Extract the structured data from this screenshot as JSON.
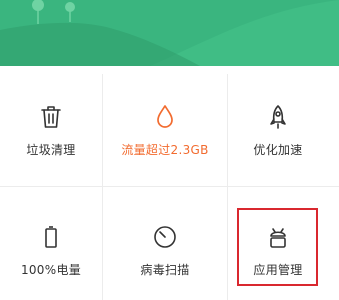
{
  "header": {
    "background": "#3ab57f",
    "hill_color": "#2f9c6c"
  },
  "grid": {
    "line_color": "#ececec",
    "items": [
      {
        "name": "trash-clean",
        "label": "垃圾清理",
        "icon": "trash-icon",
        "alert": false
      },
      {
        "name": "data-usage",
        "label": "流量超过2.3GB",
        "icon": "droplet-icon",
        "alert": true,
        "color": "#f26b2f"
      },
      {
        "name": "speed-optimize",
        "label": "优化加速",
        "icon": "rocket-icon",
        "alert": false
      },
      {
        "name": "battery",
        "label": "100%电量",
        "icon": "battery-icon",
        "alert": false
      },
      {
        "name": "virus-scan",
        "label": "病毒扫描",
        "icon": "scan-icon",
        "alert": false
      },
      {
        "name": "app-manage",
        "label": "应用管理",
        "icon": "android-icon",
        "alert": false,
        "highlighted": true,
        "highlight_color": "#d9282f"
      }
    ]
  }
}
